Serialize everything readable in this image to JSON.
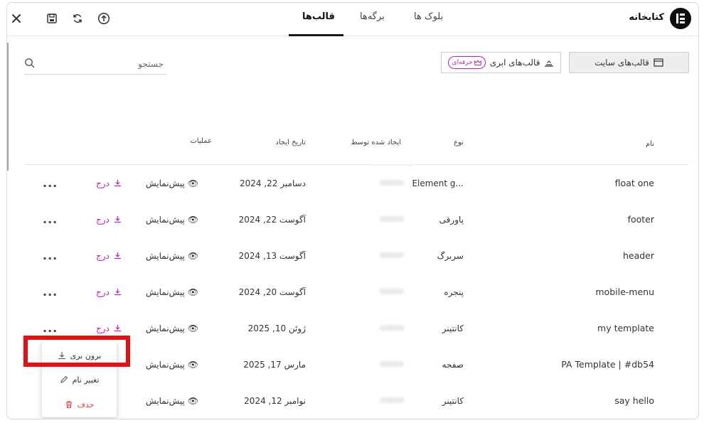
{
  "header": {
    "title": "کتابخانه",
    "tabs": [
      {
        "label": "بلوک ها",
        "active": false
      },
      {
        "label": "برگه‌ها",
        "active": false
      },
      {
        "label": "قالب‌ها",
        "active": true
      }
    ],
    "icons": [
      "close-icon",
      "save-icon",
      "sync-icon",
      "upload-icon"
    ]
  },
  "toolbar": {
    "site_templates_label": "قالب‌های سایت",
    "cloud_templates_label": "قالب‌های ابری",
    "pro_badge": "حرفه‌ای",
    "search_placeholder": "جستجو"
  },
  "columns": {
    "name": "نام",
    "type": "نوع",
    "created_by": "ایجاد شده توسط",
    "created_date": "تاریخ ایجاد",
    "actions": "عملیات"
  },
  "actions": {
    "preview": "پیش‌نمایش",
    "insert": "درج",
    "more": "..."
  },
  "rows": [
    {
      "name": "float one",
      "type": "Element g...",
      "date": "دسامبر 22, 2024"
    },
    {
      "name": "footer",
      "type": "پاورقی",
      "date": "آگوست 22, 2024"
    },
    {
      "name": "header",
      "type": "سربرگ",
      "date": "آگوست 13, 2024"
    },
    {
      "name": "mobile-menu",
      "type": "پنجره",
      "date": "آگوست 20, 2024"
    },
    {
      "name": "my template",
      "type": "کانتینر",
      "date": "ژوئن 10, 2025"
    },
    {
      "name": "PA Template | #db54",
      "type": "صفحه",
      "date": "مارس 17, 2025"
    },
    {
      "name": "say hello",
      "type": "کانتینر",
      "date": "نوامبر 12, 2024"
    }
  ],
  "context_menu": {
    "export": "برون بری",
    "rename": "تغییر نام",
    "delete": "حذف"
  },
  "colors": {
    "accent": "#c21fb6",
    "danger": "#e0424b",
    "highlight": "#e80f12"
  }
}
